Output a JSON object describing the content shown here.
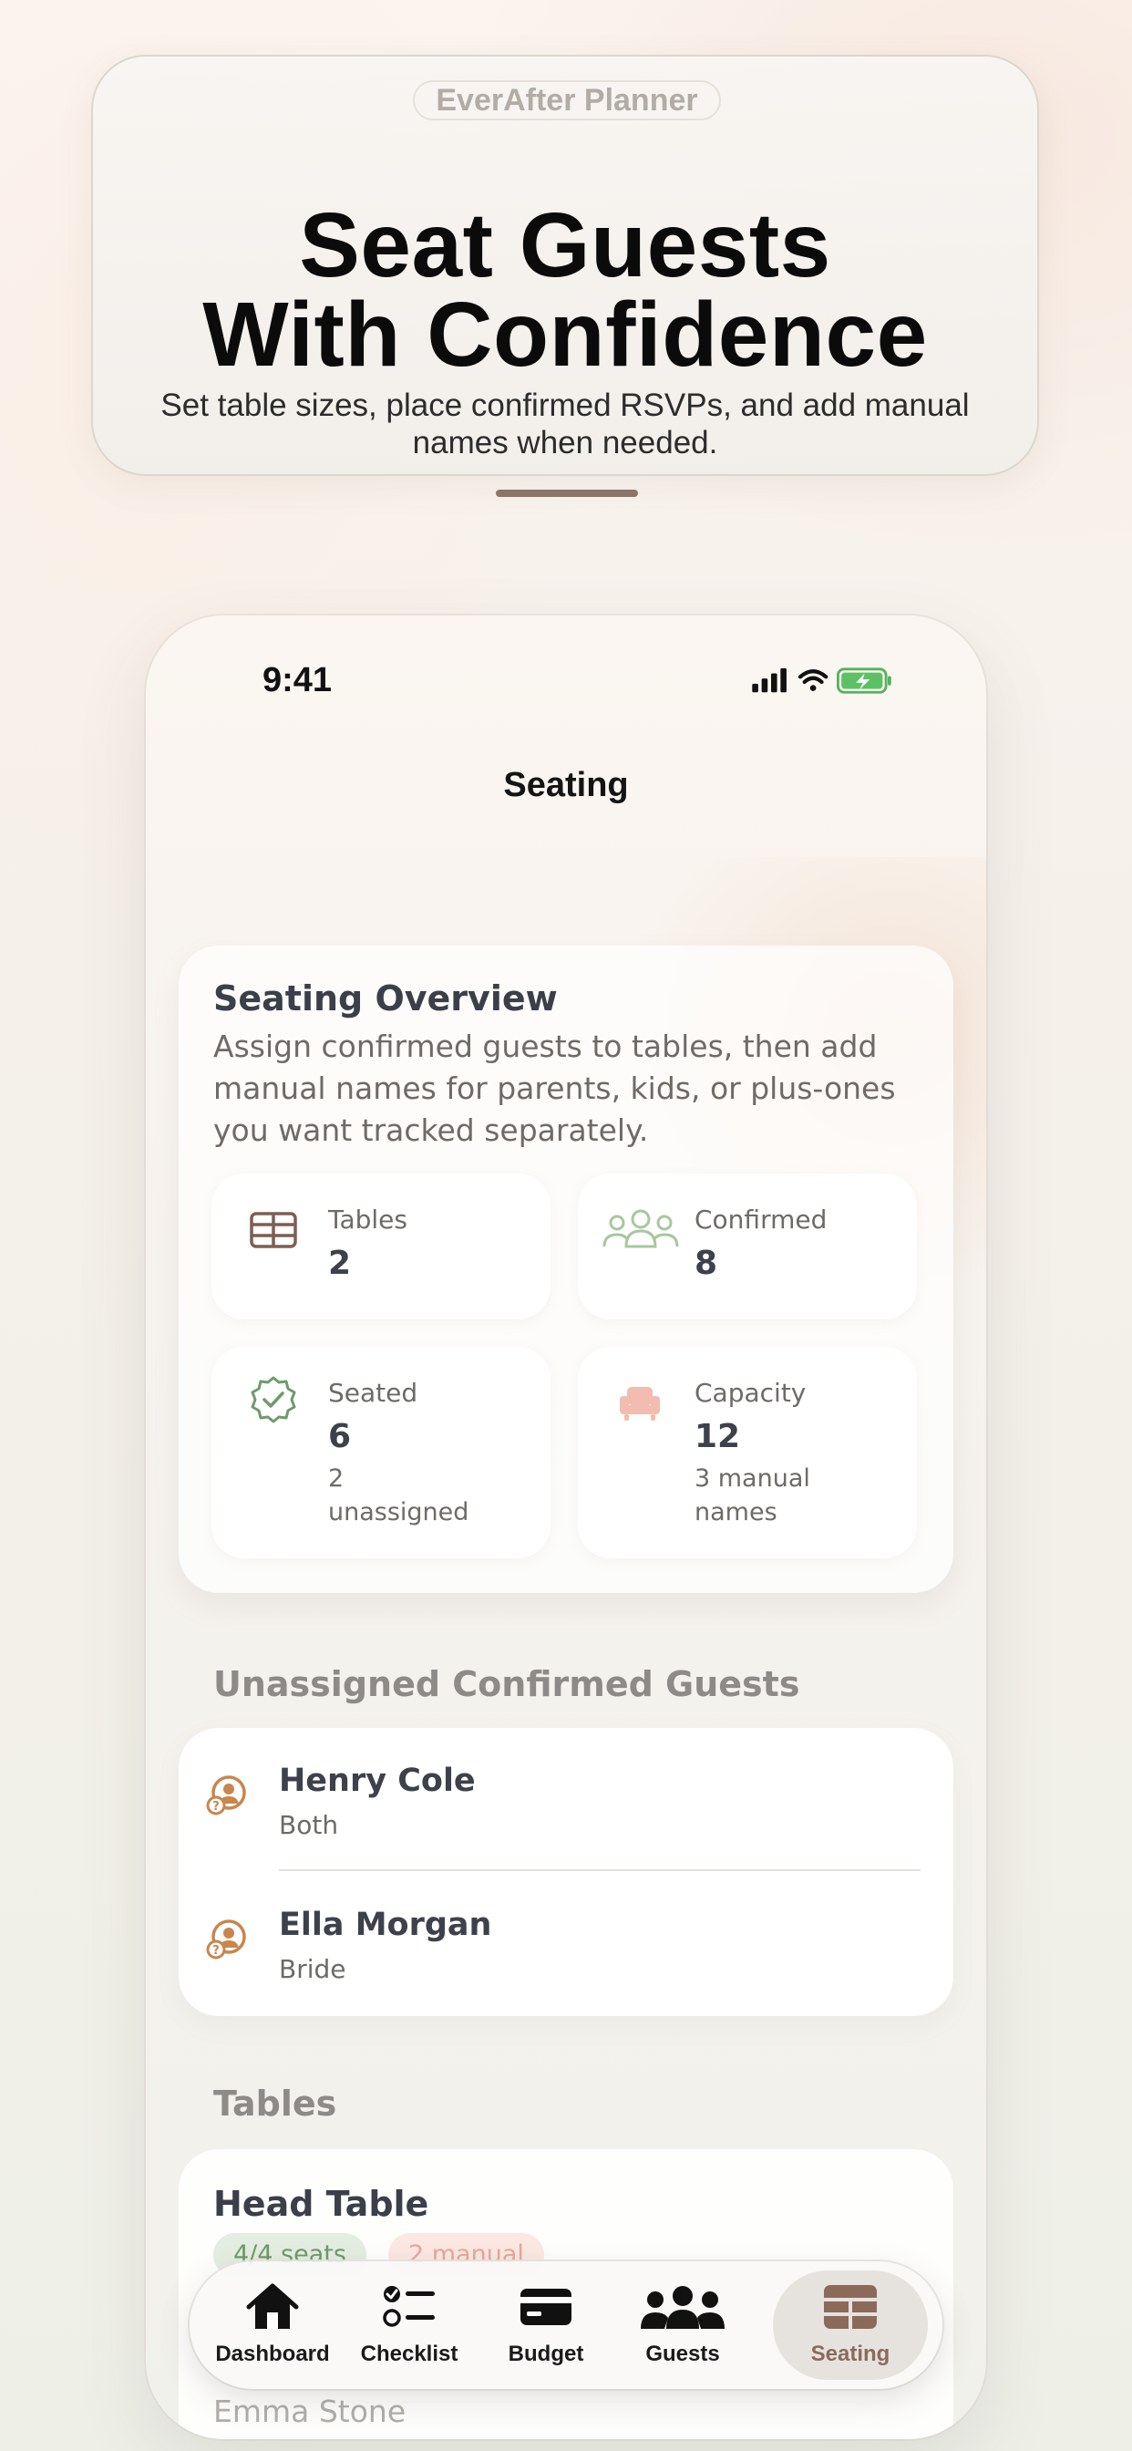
{
  "hero": {
    "brand": "EverAfter Planner",
    "title_line1": "Seat Guests",
    "title_line2": "With Confidence",
    "subtitle": "Set table sizes, place confirmed RSVPs, and add manual names when needed."
  },
  "status_bar": {
    "time": "9:41"
  },
  "nav": {
    "title": "Seating"
  },
  "overview": {
    "title": "Seating Overview",
    "description": "Assign confirmed guests to tables, then add manual names for parents, kids, or plus-ones you want tracked separately.",
    "stats": [
      {
        "label": "Tables",
        "value": "2",
        "icon": "table-grid-icon"
      },
      {
        "label": "Confirmed",
        "value": "8",
        "icon": "people-outline-icon"
      },
      {
        "label": "Seated",
        "value": "6",
        "note": "2 unassigned",
        "icon": "checkmark-seal-icon"
      },
      {
        "label": "Capacity",
        "value": "12",
        "note": "3 manual names",
        "icon": "armchair-icon"
      }
    ]
  },
  "unassigned": {
    "heading": "Unassigned Confirmed Guests",
    "guests": [
      {
        "name": "Henry Cole",
        "side": "Both"
      },
      {
        "name": "Ella Morgan",
        "side": "Bride"
      }
    ]
  },
  "tables": {
    "heading": "Tables",
    "items": [
      {
        "name": "Head Table",
        "seats_badge": "4/4 seats",
        "manual_badge": "2 manual",
        "first_guest": "Emma Stone"
      }
    ]
  },
  "tabbar": {
    "items": [
      {
        "label": "Dashboard",
        "icon": "house-icon"
      },
      {
        "label": "Checklist",
        "icon": "checklist-icon"
      },
      {
        "label": "Budget",
        "icon": "credit-card-icon"
      },
      {
        "label": "Guests",
        "icon": "people-icon"
      },
      {
        "label": "Seating",
        "icon": "table-icon",
        "active": true
      }
    ]
  },
  "colors": {
    "accent": "#8b6a5a",
    "green": "#6d9a6a",
    "orange_avatar": "#c8864e",
    "pink": "#e7a79a"
  }
}
